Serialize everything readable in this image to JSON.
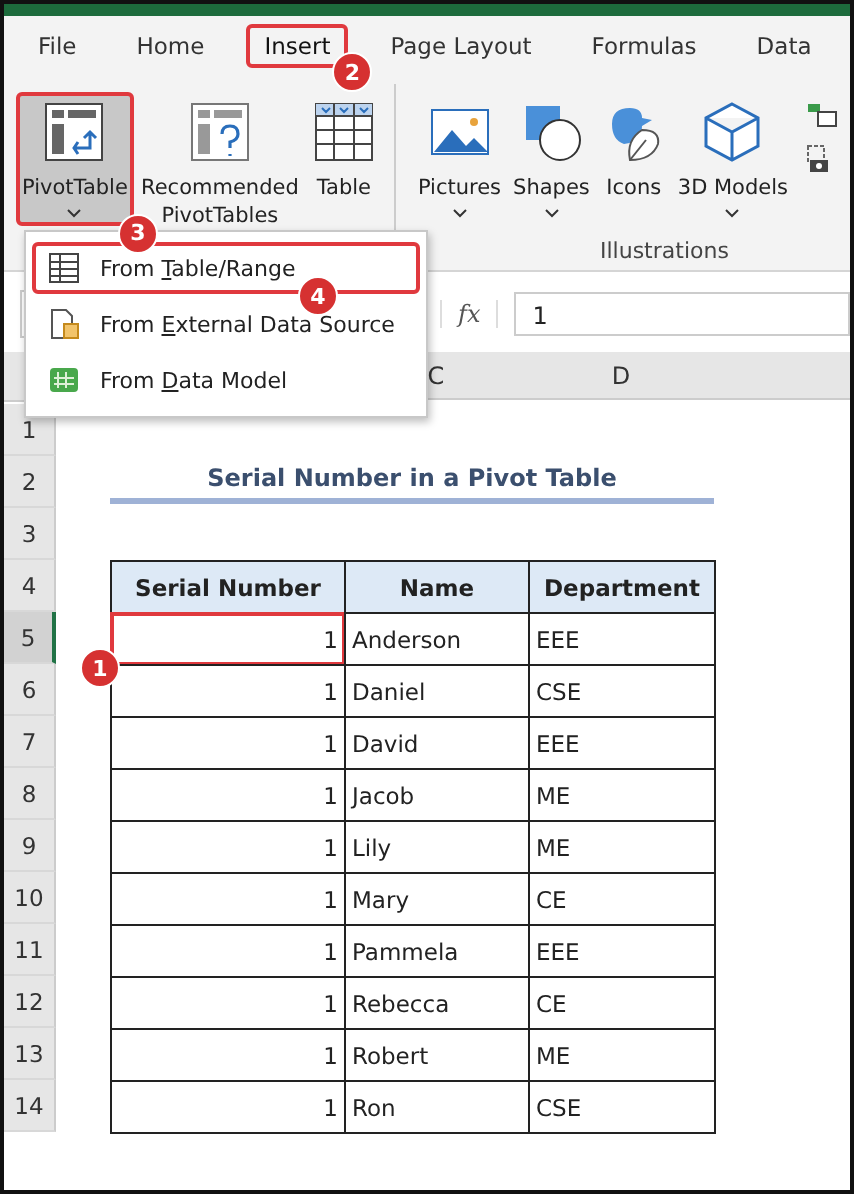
{
  "ribbon_tabs": [
    {
      "label": "File",
      "selected": false
    },
    {
      "label": "Home",
      "selected": false
    },
    {
      "label": "Insert",
      "selected": true,
      "callout": "2"
    },
    {
      "label": "Page Layout",
      "selected": false
    },
    {
      "label": "Formulas",
      "selected": false
    },
    {
      "label": "Data",
      "selected": false
    }
  ],
  "ribbon_buttons": [
    {
      "kind": "pivottable",
      "label": "PivotTable",
      "dropdown": true,
      "selected": true,
      "callout": "3"
    },
    {
      "kind": "recommended",
      "label": "Recommended PivotTables",
      "dropdown": false,
      "selected": false
    },
    {
      "kind": "table",
      "label": "Table",
      "dropdown": false,
      "selected": false
    },
    {
      "kind": "pictures",
      "label": "Pictures",
      "dropdown": true,
      "selected": false
    },
    {
      "kind": "shapes",
      "label": "Shapes",
      "dropdown": true,
      "selected": false
    },
    {
      "kind": "icons",
      "label": "Icons",
      "dropdown": false,
      "selected": false
    },
    {
      "kind": "models",
      "label": "3D Models",
      "dropdown": true,
      "selected": false
    }
  ],
  "ribbon_group": "Illustrations",
  "pivot_menu": [
    {
      "kind": "table",
      "label": "From **T**able/Range",
      "selected": true,
      "callout": "4"
    },
    {
      "kind": "external",
      "label": "From **E**xternal Data Source",
      "selected": false
    },
    {
      "kind": "model",
      "label": "From **D**ata Model",
      "selected": false
    }
  ],
  "formula_bar": {
    "fx": "fx",
    "value": "1"
  },
  "column_headers": [
    "C",
    "D"
  ],
  "row_numbers": [
    "1",
    "2",
    "3",
    "4",
    "5",
    "6",
    "7",
    "8",
    "9",
    "10",
    "11",
    "12",
    "13",
    "14"
  ],
  "sheet_title": "Serial Number in a Pivot Table",
  "table": {
    "columns": [
      "Serial Number",
      "Name",
      "Department"
    ],
    "rows": [
      {
        "cells": [
          "1",
          "Anderson",
          "EEE"
        ],
        "selected": true,
        "callout": "1"
      },
      {
        "cells": [
          "1",
          "Daniel",
          "CSE"
        ],
        "selected": false
      },
      {
        "cells": [
          "1",
          "David",
          "EEE"
        ],
        "selected": false
      },
      {
        "cells": [
          "1",
          "Jacob",
          "ME"
        ],
        "selected": false
      },
      {
        "cells": [
          "1",
          "Lily",
          "ME"
        ],
        "selected": false
      },
      {
        "cells": [
          "1",
          "Mary",
          "CE"
        ],
        "selected": false
      },
      {
        "cells": [
          "1",
          "Pammela",
          "EEE"
        ],
        "selected": false
      },
      {
        "cells": [
          "1",
          "Rebecca",
          "CE"
        ],
        "selected": false
      },
      {
        "cells": [
          "1",
          "Robert",
          "ME"
        ],
        "selected": false
      },
      {
        "cells": [
          "1",
          "Ron",
          "CSE"
        ],
        "selected": false
      }
    ]
  }
}
